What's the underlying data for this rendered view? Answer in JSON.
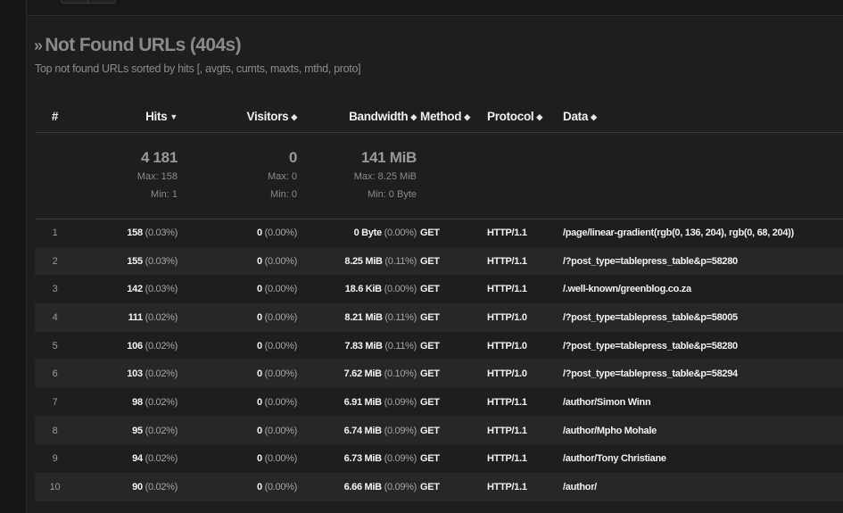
{
  "panel": {
    "title_icon": "double-chevron-right-icon",
    "title": "Not Found URLs (404s)",
    "subtitle": "Top not found URLs sorted by hits [, avgts, cumts, maxts, mthd, proto]"
  },
  "columns": {
    "index": "#",
    "hits": "Hits",
    "visitors": "Visitors",
    "bandwidth": "Bandwidth",
    "method": "Method",
    "protocol": "Protocol",
    "data": "Data",
    "sort_desc_icon": "▼",
    "sort_both_icon": "◆"
  },
  "summary": {
    "hits": {
      "total": "4 181",
      "max": "Max: 158",
      "min": "Min: 1"
    },
    "visitors": {
      "total": "0",
      "max": "Max: 0",
      "min": "Min: 0"
    },
    "bandwidth": {
      "total": "141 MiB",
      "max": "Max: 8.25 MiB",
      "min": "Min: 0 Byte"
    }
  },
  "rows": [
    {
      "index": "1",
      "hits": "158",
      "hits_pct": "(0.03%)",
      "visitors": "0",
      "visitors_pct": "(0.00%)",
      "bandwidth": "0 Byte",
      "bandwidth_pct": "(0.00%)",
      "method": "GET",
      "protocol": "HTTP/1.1",
      "data": "/page/linear-gradient(rgb(0, 136, 204), rgb(0, 68, 204))"
    },
    {
      "index": "2",
      "hits": "155",
      "hits_pct": "(0.03%)",
      "visitors": "0",
      "visitors_pct": "(0.00%)",
      "bandwidth": "8.25 MiB",
      "bandwidth_pct": "(0.11%)",
      "method": "GET",
      "protocol": "HTTP/1.1",
      "data": "/?post_type=tablepress_table&p=58280"
    },
    {
      "index": "3",
      "hits": "142",
      "hits_pct": "(0.03%)",
      "visitors": "0",
      "visitors_pct": "(0.00%)",
      "bandwidth": "18.6 KiB",
      "bandwidth_pct": "(0.00%)",
      "method": "GET",
      "protocol": "HTTP/1.1",
      "data": "/.well-known/greenblog.co.za"
    },
    {
      "index": "4",
      "hits": "111",
      "hits_pct": "(0.02%)",
      "visitors": "0",
      "visitors_pct": "(0.00%)",
      "bandwidth": "8.21 MiB",
      "bandwidth_pct": "(0.11%)",
      "method": "GET",
      "protocol": "HTTP/1.0",
      "data": "/?post_type=tablepress_table&p=58005"
    },
    {
      "index": "5",
      "hits": "106",
      "hits_pct": "(0.02%)",
      "visitors": "0",
      "visitors_pct": "(0.00%)",
      "bandwidth": "7.83 MiB",
      "bandwidth_pct": "(0.11%)",
      "method": "GET",
      "protocol": "HTTP/1.0",
      "data": "/?post_type=tablepress_table&p=58280"
    },
    {
      "index": "6",
      "hits": "103",
      "hits_pct": "(0.02%)",
      "visitors": "0",
      "visitors_pct": "(0.00%)",
      "bandwidth": "7.62 MiB",
      "bandwidth_pct": "(0.10%)",
      "method": "GET",
      "protocol": "HTTP/1.0",
      "data": "/?post_type=tablepress_table&p=58294"
    },
    {
      "index": "7",
      "hits": "98",
      "hits_pct": "(0.02%)",
      "visitors": "0",
      "visitors_pct": "(0.00%)",
      "bandwidth": "6.91 MiB",
      "bandwidth_pct": "(0.09%)",
      "method": "GET",
      "protocol": "HTTP/1.1",
      "data": "/author/Simon Winn"
    },
    {
      "index": "8",
      "hits": "95",
      "hits_pct": "(0.02%)",
      "visitors": "0",
      "visitors_pct": "(0.00%)",
      "bandwidth": "6.74 MiB",
      "bandwidth_pct": "(0.09%)",
      "method": "GET",
      "protocol": "HTTP/1.1",
      "data": "/author/Mpho Mohale"
    },
    {
      "index": "9",
      "hits": "94",
      "hits_pct": "(0.02%)",
      "visitors": "0",
      "visitors_pct": "(0.00%)",
      "bandwidth": "6.73 MiB",
      "bandwidth_pct": "(0.09%)",
      "method": "GET",
      "protocol": "HTTP/1.1",
      "data": "/author/Tony Christiane"
    },
    {
      "index": "10",
      "hits": "90",
      "hits_pct": "(0.02%)",
      "visitors": "0",
      "visitors_pct": "(0.00%)",
      "bandwidth": "6.66 MiB",
      "bandwidth_pct": "(0.09%)",
      "method": "GET",
      "protocol": "HTTP/1.1",
      "data": "/author/"
    }
  ],
  "colors": {
    "background": "#1b1b1b",
    "panel": "#1e1e1e",
    "row_alt": "#272727",
    "title": "#8a8a8a",
    "header_text": "#f0f0f0"
  }
}
